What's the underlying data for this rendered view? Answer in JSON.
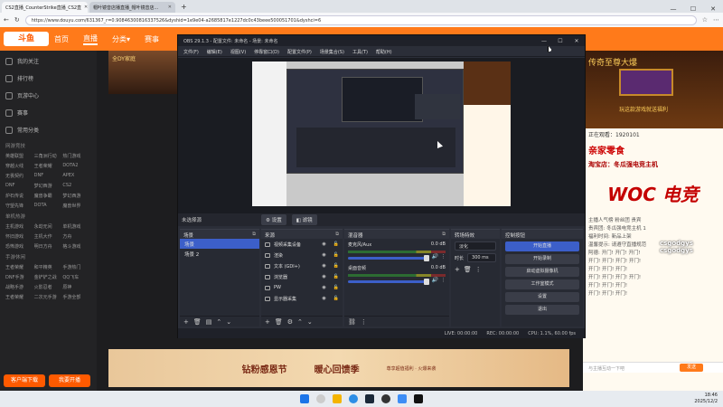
{
  "browser": {
    "tabs": [
      "CS2直播_CounterStrike直播_CS2直",
      "帽叶镜音店播直播_帽叶镜音店..."
    ],
    "url": "https://www.douyu.com/631367_r=0.90846300816337526&dyshid=1e9e04-a2685817e1227dc0c43beee500051701&dyshci=6"
  },
  "site": {
    "logo": "斗鱼",
    "nav": [
      "首页",
      "直播",
      "分类▾",
      "赛事"
    ]
  },
  "sidebar": {
    "items": [
      "我的关注",
      "排行榜",
      "页游中心",
      "赛事",
      "常用分类"
    ],
    "sections": [
      {
        "title": "网游竞技",
        "items": [
          "英雄联盟",
          "三角洲行动",
          "热门游戏",
          "穿越火线",
          "王者荣耀",
          "DOTA2",
          "无畏契约",
          "DNF",
          "APEX",
          "DNF",
          "梦幻西游",
          "CS2",
          "炉石传说",
          "魔兽争霸",
          "梦幻西游",
          "守望先锋",
          "DOTA",
          "魔兽世界"
        ]
      },
      {
        "title": "单机热游",
        "items": [
          "主机游戏",
          "永劫无间",
          "单机游戏",
          "怀旧游戏",
          "主机大作",
          "方舟",
          "恐怖游戏",
          "明日方舟",
          "格斗游戏"
        ]
      },
      {
        "title": "手游休闲",
        "items": [
          "王者荣耀",
          "和平精英",
          "手游热门",
          "DNF手游",
          "金铲铲之战",
          "QQ飞车",
          "战略手游",
          "火影忍者",
          "原神",
          "王者荣耀",
          "二次元手游",
          "手游全部"
        ]
      }
    ],
    "buttons": [
      "客户端下载",
      "我要开播"
    ]
  },
  "banner": {
    "text": "全DY家庭"
  },
  "bottom_banner": {
    "left": "钻粉感恩节",
    "center": "暖心回馈季",
    "sub": "尊享超值福利 · 火爆来袭"
  },
  "chat": {
    "ad_title": "传奇至尊大爆",
    "ad_promo": "玩这款游戏就送福利",
    "row1": "正在观看：1920101",
    "shop_text": "亲家零食",
    "taobao": "淘宝店：冬瓜强电竞主机",
    "woc": "WOC 电竞",
    "lines": [
      "主播人气榜 粉丝团 贵宾",
      "贵宾团: 冬瓜强电竞主机 1",
      "福利时间: 新品上架",
      "温馨提示: 请遵守直播规范",
      "阿德: 开门! 开门! 开门!",
      "开门! 开门! 开门! 开门!",
      "开门! 开门! 开门!",
      "开门! 开门! 开门! 开门!",
      "开门! 开门! 开门!",
      "开门! 开门! 开门!"
    ],
    "tags": [
      "csgodgys",
      "csgodgys"
    ],
    "input_placeholder": "与主播互动一下吧",
    "send_label": "发送"
  },
  "obs": {
    "title": "OBS 29.1.3 - 配置文件: 未命名 - 场景: 未命名",
    "menu": [
      "文件(F)",
      "编辑(E)",
      "视图(V)",
      "停靠窗口(D)",
      "配置文件(P)",
      "场景集合(S)",
      "工具(T)",
      "帮助(H)"
    ],
    "no_source": "未选择源",
    "properties_btn": "设置",
    "filters_btn": "滤镜",
    "scenes": {
      "title": "场景",
      "items": [
        "场景",
        "场景 2"
      ]
    },
    "sources": {
      "title": "来源",
      "items": [
        "视频采集设备",
        "渲染",
        "文本 (GDI+)",
        "浏览器",
        "PW",
        "显示器采集"
      ]
    },
    "mixer": {
      "title": "混音器",
      "channels": [
        {
          "name": "麦克风/Aux",
          "db": "0.0 dB"
        },
        {
          "name": "桌面音频",
          "db": "0.0 dB"
        }
      ]
    },
    "transitions": {
      "title": "转场特效",
      "type": "淡化",
      "duration_label": "时长",
      "duration": "300 ms"
    },
    "controls": {
      "title": "控制按钮",
      "buttons": [
        "开始直播",
        "开始录制",
        "启动虚拟摄像机",
        "工作室模式",
        "设置",
        "退出"
      ]
    },
    "status": {
      "live": "LIVE: 00:00:00",
      "rec": "REC: 00:00:00",
      "cpu": "CPU: 1.1%, 60.00 fps"
    }
  },
  "taskbar": {
    "time": "18:46",
    "date": "2025/12/2"
  }
}
